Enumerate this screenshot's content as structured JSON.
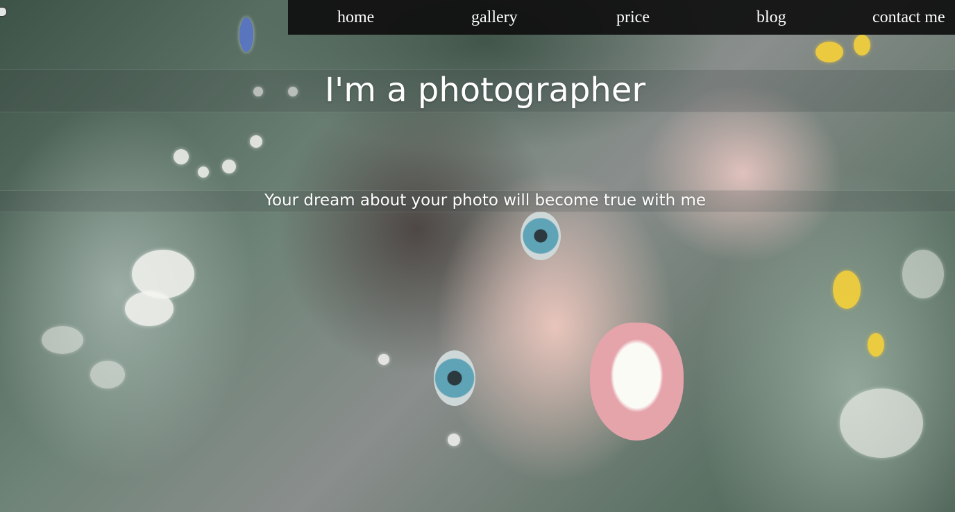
{
  "nav": {
    "items": [
      {
        "label": "home"
      },
      {
        "label": "gallery"
      },
      {
        "label": "price"
      },
      {
        "label": "blog"
      },
      {
        "label": "contact me"
      }
    ]
  },
  "hero": {
    "title": "I'm a photographer",
    "subtitle": "Your dream about your photo will become true with me"
  },
  "colors": {
    "nav_background": "#0f0f0f",
    "text": "#ffffff"
  }
}
